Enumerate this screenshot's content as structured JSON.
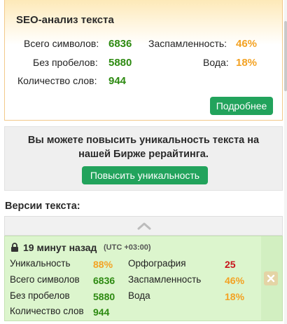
{
  "seo": {
    "title": "SEO-анализ текста",
    "total_chars_label": "Всего символов:",
    "total_chars_value": "6836",
    "no_spaces_label": "Без пробелов:",
    "no_spaces_value": "5880",
    "word_count_label": "Количество слов:",
    "word_count_value": "944",
    "spam_label": "Заспамленность:",
    "spam_value": "46%",
    "water_label": "Вода:",
    "water_value": "18%",
    "more_button": "Подробнее"
  },
  "promo": {
    "text_line1": "Вы можете повысить уникальность текста на",
    "text_line2": "нашей Бирже рерайтинга.",
    "button": "Повысить уникальность"
  },
  "versions": {
    "title": "Версии текста:",
    "items": [
      {
        "time": "19 минут назад",
        "timezone": "(UTC +03:00)",
        "uniqueness_label": "Уникальность",
        "uniqueness_value": "88%",
        "total_chars_label": "Всего символов",
        "total_chars_value": "6836",
        "no_spaces_label": "Без пробелов",
        "no_spaces_value": "5880",
        "word_count_label": "Количество слов",
        "word_count_value": "944",
        "spelling_label": "Орфография",
        "spelling_value": "25",
        "spam_label": "Заспамленность",
        "spam_value": "46%",
        "water_label": "Вода",
        "water_value": "18%"
      }
    ]
  },
  "icons": {
    "collapse": "chevron-up-icon",
    "lock": "lock-icon",
    "delete": "close-icon"
  },
  "colors": {
    "good": "#2d8a11",
    "warn": "#f3a223",
    "bad": "#c7141b",
    "button": "#22a35c"
  }
}
